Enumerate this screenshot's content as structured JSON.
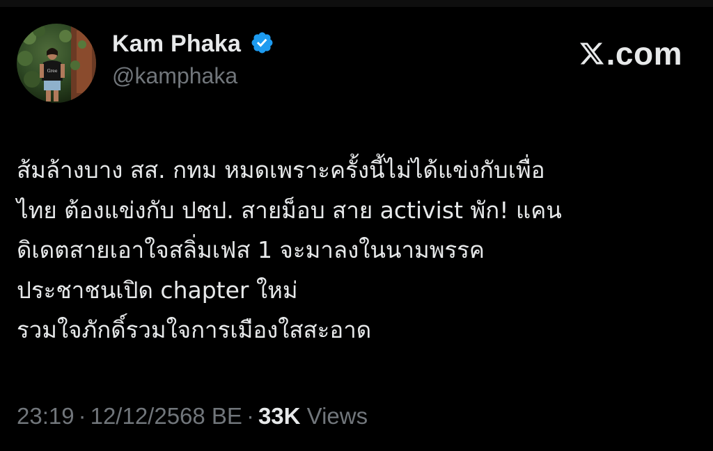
{
  "post": {
    "author": {
      "display_name": "Kam Phaka",
      "handle": "@kamphaka",
      "verified": true,
      "verified_icon": "verified-badge-icon",
      "verified_color": "#1d9bf0"
    },
    "brand": {
      "label": ".com",
      "icon": "x-logo-icon"
    },
    "text_lines": [
      "ส้มล้างบาง สส. กทม หมดเพราะครั้งนี้ไม่ได้แข่งกับเพื่อ",
      "ไทย ต้องแข่งกับ ปชป. สายม็อบ สาย activist พัก! แคน",
      "ดิเดตสายเอาใจสลิ่มเฟส 1 จะมาลงในนามพรรค",
      "ประชาชนเปิด chapter ใหม่",
      "รวมใจภักดิ์รวมใจการเมืองใสสะอาด"
    ],
    "meta": {
      "time": "23:19",
      "separator": "·",
      "date": "12/12/2568 BE",
      "views_count": "33K",
      "views_label": "Views"
    },
    "colors": {
      "background": "#000000",
      "text_primary": "#e7e9ea",
      "text_secondary": "#71767b"
    }
  }
}
